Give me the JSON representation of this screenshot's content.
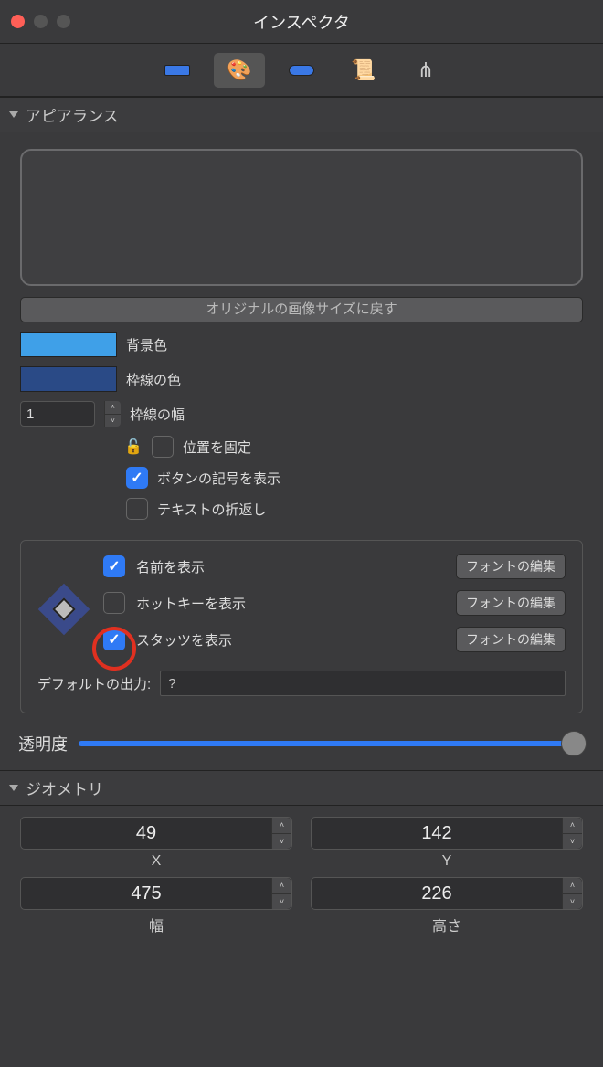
{
  "window": {
    "title": "インスペクタ"
  },
  "sections": {
    "appearance": "アピアランス",
    "geometry": "ジオメトリ"
  },
  "appearance": {
    "reset_btn": "オリジナルの画像サイズに戻す",
    "bg_color_label": "背景色",
    "border_color_label": "枠線の色",
    "border_width_label": "枠線の幅",
    "border_width_value": "1",
    "lock_label": "位置を固定",
    "show_symbol_label": "ボタンの記号を表示",
    "text_wrap_label": "テキストの折返し",
    "show_name_label": "名前を表示",
    "show_hotkey_label": "ホットキーを表示",
    "show_stats_label": "スタッツを表示",
    "font_edit_btn": "フォントの編集",
    "default_output_label": "デフォルトの出力:",
    "default_output_value": "?",
    "opacity_label": "透明度",
    "checks": {
      "lock": false,
      "symbol": true,
      "wrap": false,
      "name": true,
      "hotkey": false,
      "stats": true
    },
    "colors": {
      "bg": "#3fa0e8",
      "border": "#2a4a86"
    }
  },
  "geometry": {
    "x_label": "X",
    "x_value": "49",
    "y_label": "Y",
    "y_value": "142",
    "w_label": "幅",
    "w_value": "475",
    "h_label": "高さ",
    "h_value": "226"
  }
}
